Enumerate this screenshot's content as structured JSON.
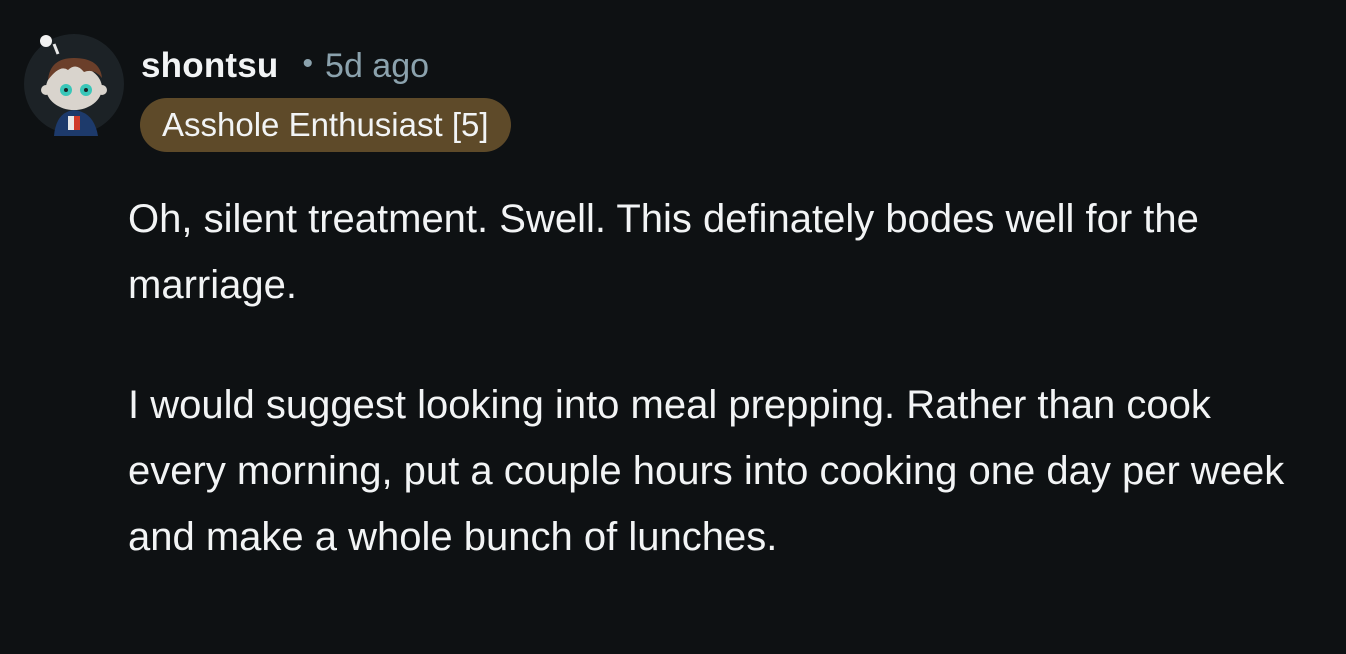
{
  "comment": {
    "author": "shontsu",
    "separator": "•",
    "time_ago": "5d ago",
    "flair": "Asshole Enthusiast [5]",
    "paragraphs": [
      "Oh, silent treatment. Swell. This definately bodes well for the marriage.",
      "I would suggest looking into meal prepping. Rather than cook every morning, put a couple hours into cooking one day per week and make a whole bunch of lunches."
    ]
  },
  "colors": {
    "background": "#0e1113",
    "text": "#f2f4f5",
    "muted": "#8ba2ad",
    "flair_background": "#5e4a29"
  },
  "icons": {
    "avatar": "snoo-avatar-icon"
  }
}
